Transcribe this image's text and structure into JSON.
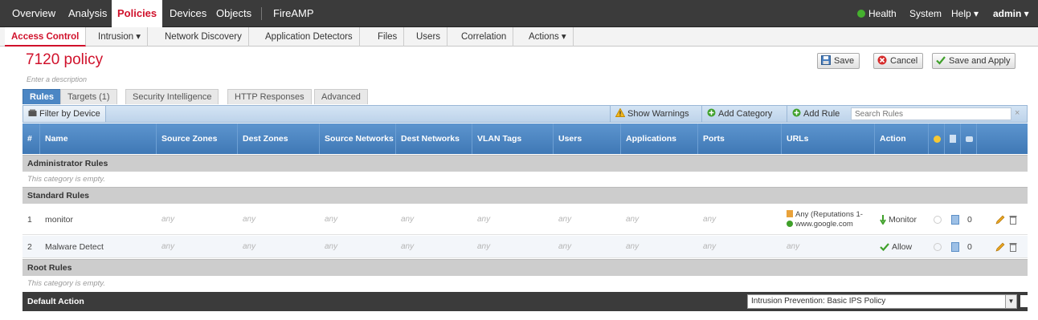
{
  "topnav": {
    "items": [
      "Overview",
      "Analysis",
      "Policies",
      "Devices",
      "Objects",
      "FireAMP"
    ],
    "health": "Health",
    "system": "System",
    "help": "Help ▾",
    "user": "admin ▾"
  },
  "subnav": {
    "items": [
      "Access Control",
      "Intrusion ▾",
      "Network Discovery",
      "Application Detectors",
      "Files",
      "Users",
      "Correlation",
      "Actions ▾"
    ]
  },
  "policy": {
    "title": "7120 policy",
    "description": "Enter a description"
  },
  "buttons": {
    "save": "Save",
    "cancel": "Cancel",
    "save_apply": "Save and Apply"
  },
  "tabs": [
    "Rules",
    "Targets (1)",
    "Security Intelligence",
    "HTTP Responses",
    "Advanced"
  ],
  "toolbar": {
    "filter": "Filter by Device",
    "show_warnings": "Show Warnings",
    "add_category": "Add Category",
    "add_rule": "Add Rule",
    "search_placeholder": "Search Rules"
  },
  "columns": [
    "#",
    "Name",
    "Source Zones",
    "Dest Zones",
    "Source Networks",
    "Dest Networks",
    "VLAN Tags",
    "Users",
    "Applications",
    "Ports",
    "URLs",
    "Action"
  ],
  "categories": {
    "administrator": "Administrator Rules",
    "standard": "Standard Rules",
    "root": "Root Rules",
    "empty_text": "This category is empty."
  },
  "rules": [
    {
      "num": "1",
      "name": "monitor",
      "source_zones": "any",
      "dest_zones": "any",
      "source_networks": "any",
      "dest_networks": "any",
      "vlan_tags": "any",
      "users": "any",
      "applications": "any",
      "ports": "any",
      "url_line1": "Any (Reputations 1-",
      "url_line2": "www.google.com",
      "action": "Monitor",
      "count": "0"
    },
    {
      "num": "2",
      "name": "Malware Detect",
      "source_zones": "any",
      "dest_zones": "any",
      "source_networks": "any",
      "dest_networks": "any",
      "vlan_tags": "any",
      "users": "any",
      "applications": "any",
      "ports": "any",
      "urls": "any",
      "action": "Allow",
      "count": "0"
    }
  ],
  "default_action": {
    "label": "Default Action",
    "value": "Intrusion Prevention: Basic IPS Policy"
  },
  "colors": {
    "brand_red": "#d0112b",
    "header_blue": "#4a86c4",
    "nav_dark": "#3b3b3b"
  }
}
